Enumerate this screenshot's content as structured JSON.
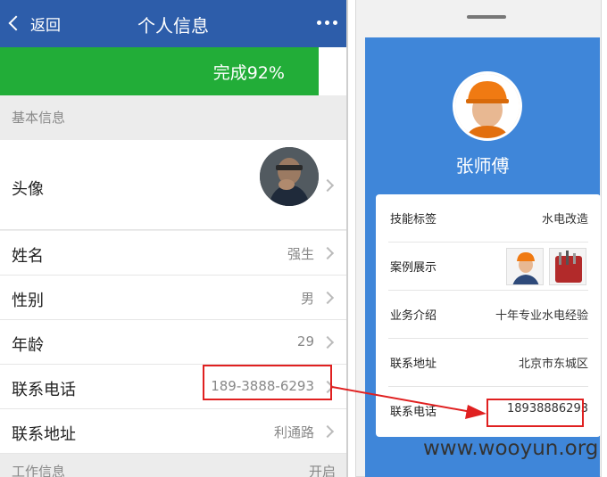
{
  "left_screen": {
    "header": {
      "back_label": "返回",
      "title": "个人信息"
    },
    "progress": {
      "label": "完成92%",
      "fraction": 0.92
    },
    "section_basic": "基本信息",
    "rows": {
      "avatar": {
        "label": "头像"
      },
      "name": {
        "label": "姓名",
        "value": "强生"
      },
      "gender": {
        "label": "性别",
        "value": "男"
      },
      "age": {
        "label": "年龄",
        "value": "29"
      },
      "phone": {
        "label": "联系电话",
        "value": "189-3888-6293"
      },
      "address": {
        "label": "联系地址",
        "value": "利通路"
      }
    },
    "section_work": {
      "label": "工作信息",
      "value": "开启"
    }
  },
  "right_screen": {
    "profile_name": "张师傅",
    "card": {
      "skills": {
        "label": "技能标签",
        "value": "水电改造"
      },
      "cases": {
        "label": "案例展示"
      },
      "intro": {
        "label": "业务介绍",
        "value": "十年专业水电经验"
      },
      "address": {
        "label": "联系地址",
        "value": "北京市东城区"
      },
      "phone": {
        "label": "联系电话",
        "value": "18938886293"
      }
    }
  },
  "watermark": "www.wooyun.org",
  "colors": {
    "header_blue": "#2d5daa",
    "progress_green": "#22ad38",
    "profile_blue": "#3f86d9",
    "highlight_red": "#e02020"
  }
}
